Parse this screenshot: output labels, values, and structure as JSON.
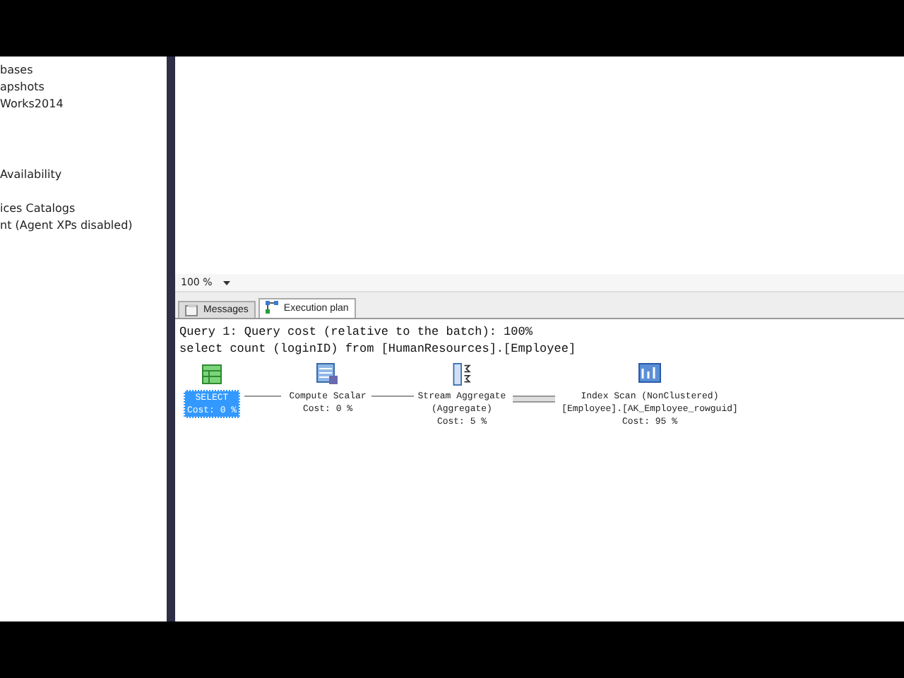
{
  "object_explorer": {
    "items": [
      "bases",
      "apshots",
      "Works2014",
      "Availability",
      "ices Catalogs",
      "nt (Agent XPs disabled)"
    ]
  },
  "zoom": {
    "value": "100 %"
  },
  "tabs": [
    {
      "label": "Messages",
      "selected": false,
      "kind": "messages"
    },
    {
      "label": "Execution plan",
      "selected": true,
      "kind": "plan"
    }
  ],
  "query_header": [
    "Query 1: Query cost (relative to the batch): 100%",
    "select count (loginID) from [HumanResources].[Employee]"
  ],
  "plan_nodes": [
    {
      "kind": "select",
      "lines": [
        "SELECT",
        "Cost: 0 %"
      ],
      "selected": true
    },
    {
      "kind": "compute",
      "lines": [
        "Compute Scalar",
        "Cost: 0 %"
      ],
      "selected": false
    },
    {
      "kind": "aggregate",
      "lines": [
        "Stream Aggregate",
        "(Aggregate)",
        "Cost: 5 %"
      ],
      "selected": false
    },
    {
      "kind": "scan",
      "lines": [
        "Index Scan (NonClustered)",
        "[Employee].[AK_Employee_rowguid]",
        "Cost: 95 %"
      ],
      "selected": false
    }
  ]
}
